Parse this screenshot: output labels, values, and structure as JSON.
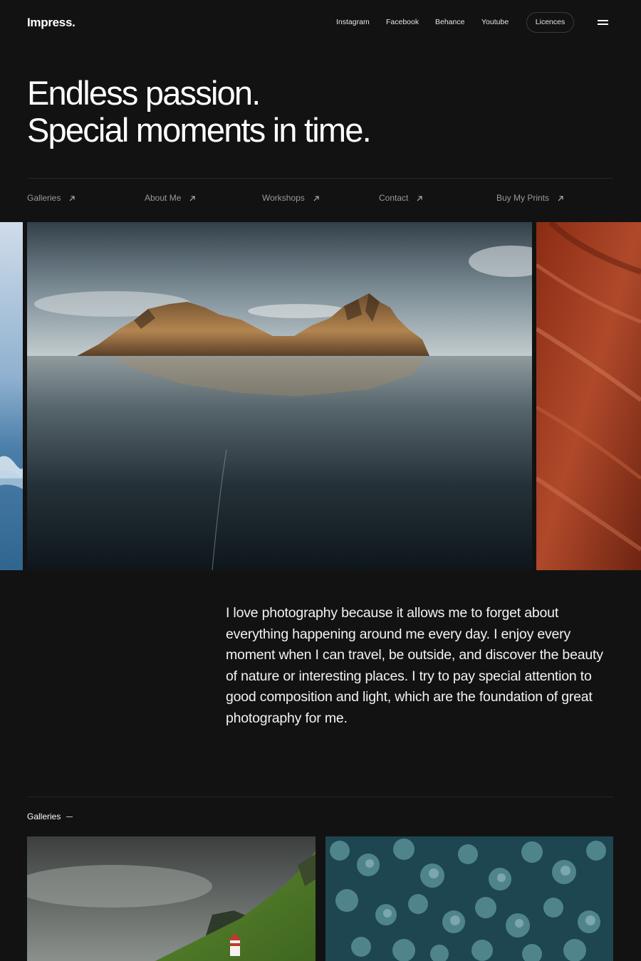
{
  "header": {
    "logo": "Impress.",
    "nav": [
      "Instagram",
      "Facebook",
      "Behance",
      "Youtube"
    ],
    "licences": "Licences"
  },
  "hero": {
    "line1": "Endless passion.",
    "line2": "Special moments in time."
  },
  "sublinks": [
    "Galleries",
    "About Me",
    "Workshops",
    "Contact",
    "Buy My Prints"
  ],
  "about": {
    "text": "I love photography because it allows me to forget about everything happening around me every day. I enjoy every moment when I can travel, be outside, and discover the beauty of nature or interesting places. I try to pay special attention to good composition and light, which are the foundation of great photography for me."
  },
  "galleries": {
    "label": "Galleries"
  },
  "colors": {
    "background": "#121212",
    "text": "#ffffff",
    "muted": "#9a9a9a"
  },
  "icons": {
    "link_arrow": "arrow-up-right-icon",
    "menu": "hamburger-menu-icon"
  }
}
